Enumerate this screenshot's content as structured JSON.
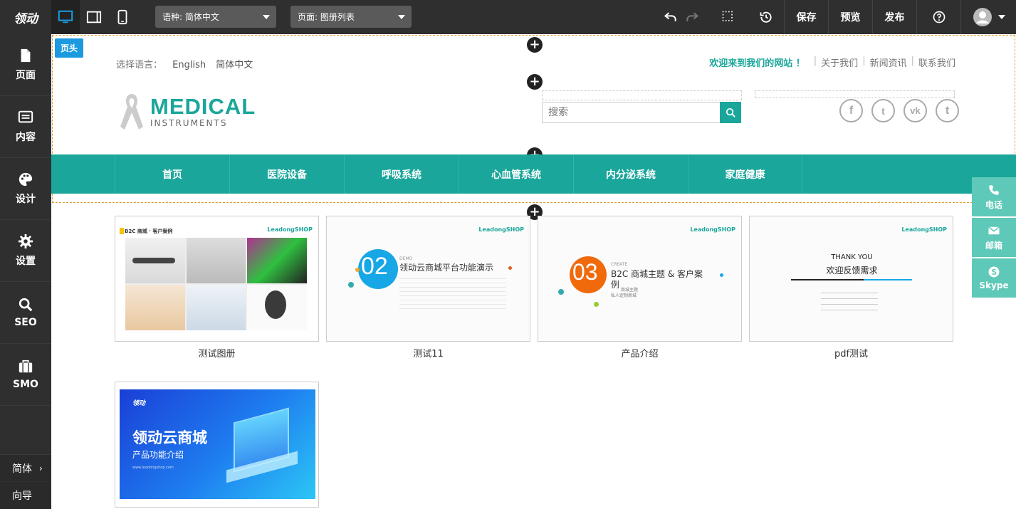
{
  "toolbar": {
    "logo_text": "领动",
    "language_select": "语种: 简体中文",
    "page_select": "页面: 图册列表",
    "save": "保存",
    "preview": "预览",
    "publish": "发布"
  },
  "sidebar": {
    "items": [
      {
        "label": "页面",
        "icon": "page-icon"
      },
      {
        "label": "内容",
        "icon": "content-icon"
      },
      {
        "label": "设计",
        "icon": "palette-icon"
      },
      {
        "label": "设置",
        "icon": "gear-icon"
      },
      {
        "label": "SEO",
        "icon": "search-icon"
      },
      {
        "label": "SMO",
        "icon": "briefcase-icon"
      }
    ],
    "lang_switch": "简体",
    "guide": "向导"
  },
  "site_header": {
    "tag": "页头",
    "lang_label": "选择语言：",
    "lang_options": [
      "English",
      "简体中文"
    ],
    "welcome": "欢迎来到我们的网站 ！",
    "links": [
      "关于我们",
      "新闻资讯",
      "联系我们"
    ],
    "brand_main": "MEDICAL",
    "brand_sub": "INSTRUMENTS",
    "search_placeholder": "搜索",
    "social": [
      "f",
      "t",
      "vk",
      "t"
    ]
  },
  "nav": [
    "首页",
    "医院设备",
    "呼吸系统",
    "心血管系统",
    "内分泌系统",
    "家庭健康"
  ],
  "albums": [
    {
      "caption": "测试图册"
    },
    {
      "caption": "测试11"
    },
    {
      "caption": "产品介绍"
    },
    {
      "caption": "pdf测试"
    },
    {
      "caption": ""
    }
  ],
  "album_content": {
    "card1_title": "B2C 商城 · 客户案例",
    "shop_logo": "LeadongSHOP",
    "card2_num": "02",
    "card2_label": "DEMO",
    "card2_title": "领动云商城平台功能演示",
    "card3_num": "03",
    "card3_label": "CREATE",
    "card3_title": "B2C 商城主题 & 客户案例",
    "card3_sub": "商城主题",
    "card3_sub2": "私人定制商城",
    "card4_title1": "THANK YOU",
    "card4_title2": "欢迎反馈需求",
    "card5_logo": "领动",
    "card5_title": "领动云商城",
    "card5_sub": "产品功能介绍",
    "card5_url": "www.leadongshop.com"
  },
  "contact_float": [
    {
      "label": "电话",
      "icon": "phone-icon"
    },
    {
      "label": "邮箱",
      "icon": "mail-icon"
    },
    {
      "label": "Skype",
      "icon": "skype-icon"
    }
  ],
  "colors": {
    "brand": "#1aa69a",
    "toolbar": "#2f2f2f",
    "accent": "#1b9ae0"
  }
}
